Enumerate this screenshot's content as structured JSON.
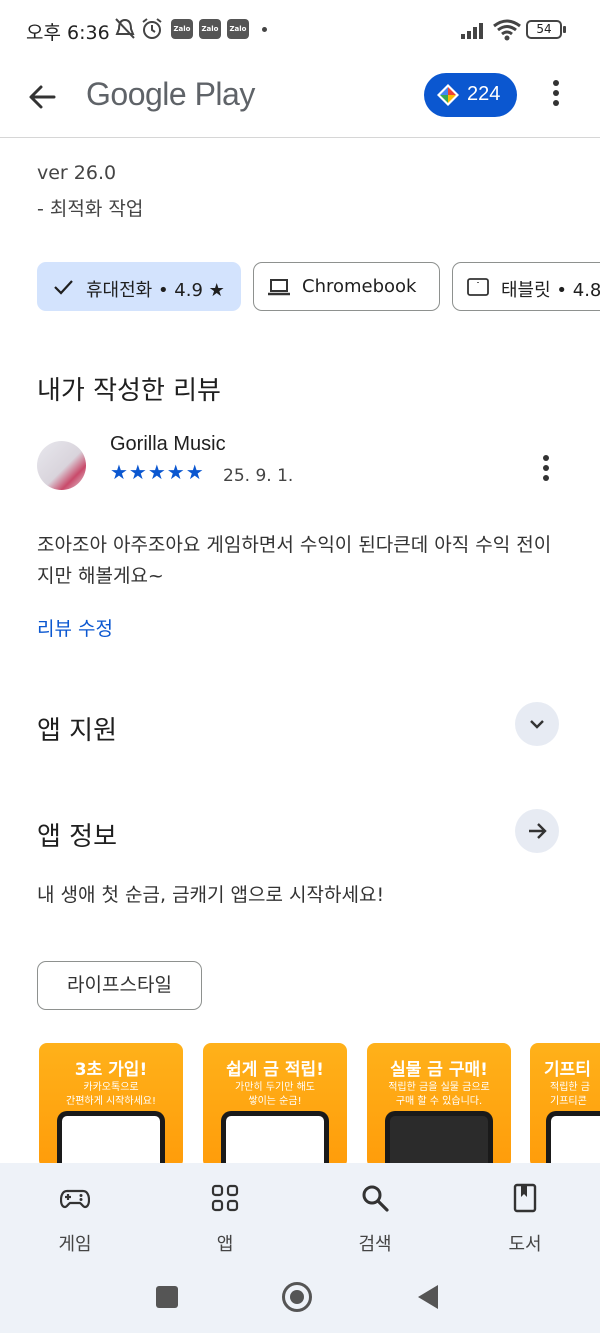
{
  "status_bar": {
    "time": "오후 6:36",
    "zalo_label": "Zalo",
    "battery": "54"
  },
  "app_bar": {
    "title": "Google Play",
    "points": "224"
  },
  "whats_new": {
    "version": "ver 26.0",
    "note": "- 최적화 작업"
  },
  "device_chips": [
    {
      "label": "휴대전화 • 4.9 ★",
      "selected": true
    },
    {
      "label": "Chromebook",
      "selected": false
    },
    {
      "label": "태블릿 • 4.8",
      "selected": false
    }
  ],
  "my_review": {
    "section_title": "내가 작성한 리뷰",
    "reviewer": "Gorilla Music",
    "stars": "★★★★★",
    "rating": 5,
    "date": "25. 9. 1.",
    "text": "조아조아 아주조아요 게임하면서 수익이 된다큰데 아직 수익 전이지만 해볼게요~",
    "edit_label": "리뷰 수정"
  },
  "app_support": {
    "title": "앱 지원"
  },
  "app_info": {
    "title": "앱 정보",
    "description": "내 생애 첫 순금, 금캐기 앱으로 시작하세요!",
    "category": "라이프스타일"
  },
  "screenshots": [
    {
      "headline": "3초 가입!",
      "sub1": "카카오톡으로",
      "sub2": "간편하게 시작하세요!"
    },
    {
      "headline": "쉽게 금 적립!",
      "sub1": "가만히 두기만 해도",
      "sub2": "쌓이는 순금!"
    },
    {
      "headline": "실물 금 구매!",
      "sub1": "적립한 금을 실물 금으로",
      "sub2": "구매 할 수 있습니다."
    },
    {
      "headline": "기프티",
      "sub1": "적립한 금",
      "sub2": "기프티콘"
    }
  ],
  "bottom_nav": {
    "items": [
      {
        "label": "게임",
        "icon": "gamepad-icon"
      },
      {
        "label": "앱",
        "icon": "apps-grid-icon"
      },
      {
        "label": "검색",
        "icon": "search-icon"
      },
      {
        "label": "도서",
        "icon": "book-icon"
      }
    ]
  },
  "colors": {
    "accent": "#0b57d0",
    "chip_selected": "#d3e3fd",
    "nav_bg": "#eef2f8"
  }
}
